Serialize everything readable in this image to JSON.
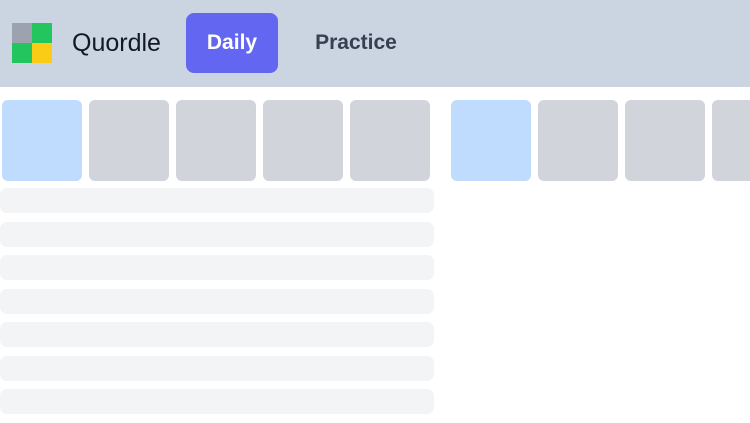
{
  "header": {
    "app_title": "Quordle",
    "logo": {
      "icon": "quordle-logo-icon",
      "colors": [
        "#9ca3af",
        "#22c55e",
        "#22c55e",
        "#facc15"
      ]
    },
    "tabs": [
      {
        "label": "Daily",
        "active": true
      },
      {
        "label": "Practice",
        "active": false
      }
    ]
  },
  "colors": {
    "header_bg": "#cbd5e1",
    "active_tab": "#6366f1",
    "tile_active": "#bfdbfe",
    "tile_empty": "#d1d5db",
    "row_placeholder": "#f3f4f6"
  },
  "boards": [
    {
      "tiles": [
        "active",
        "empty",
        "empty",
        "empty",
        "empty"
      ],
      "placeholder_rows": 7
    },
    {
      "tiles": [
        "active",
        "empty",
        "empty",
        "empty"
      ],
      "placeholder_rows": 7
    }
  ]
}
